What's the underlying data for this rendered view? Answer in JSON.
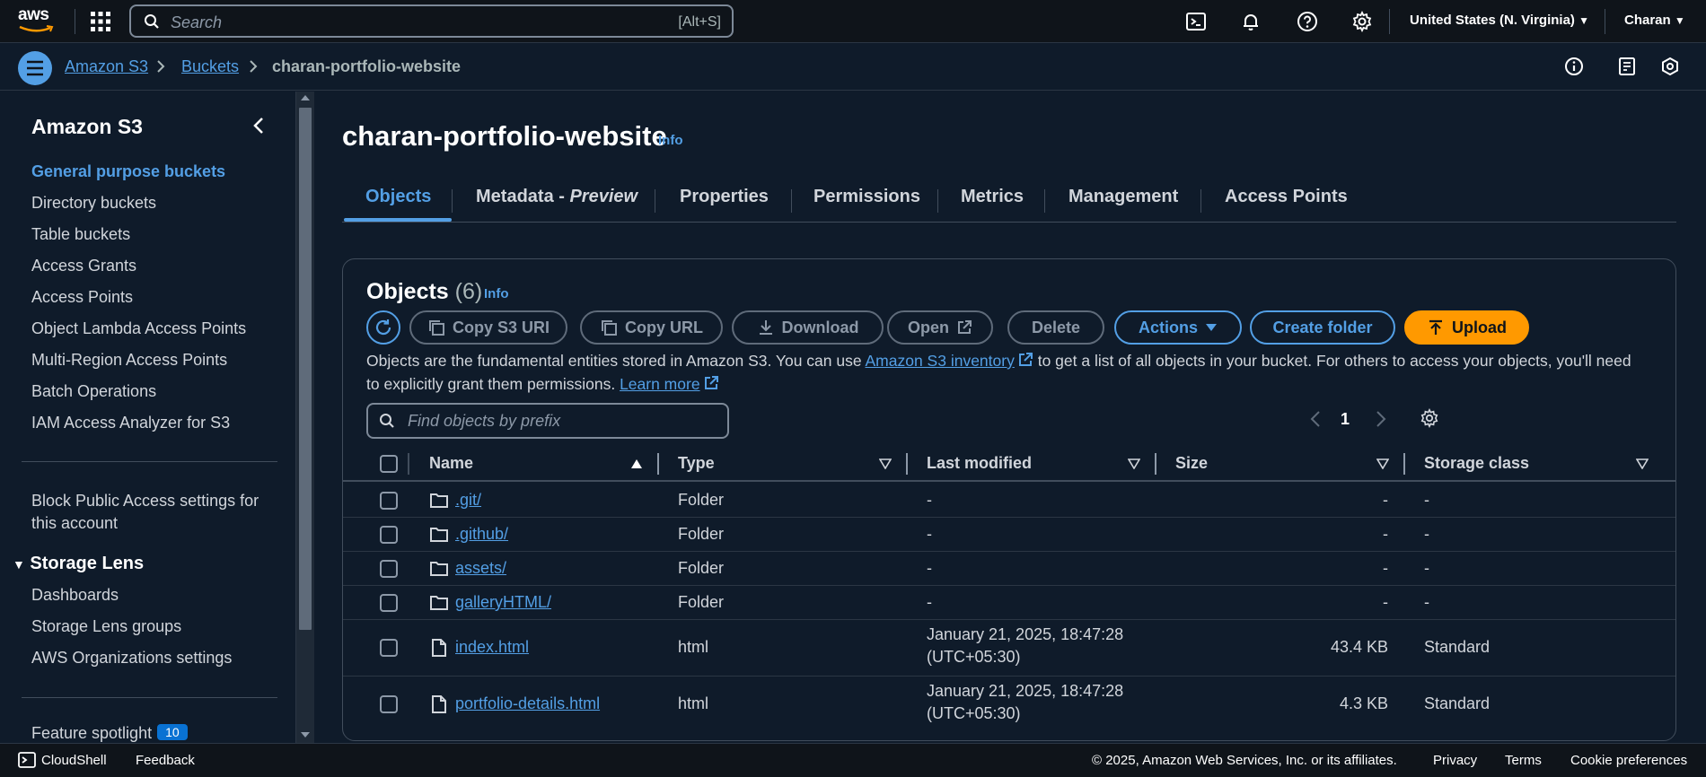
{
  "topnav": {
    "logo_text": "aws",
    "search_placeholder": "Search",
    "search_shortcut": "[Alt+S]",
    "region": "United States (N. Virginia)",
    "user": "Charan"
  },
  "breadcrumbs": {
    "items": [
      "Amazon S3",
      "Buckets"
    ],
    "current": "charan-portfolio-website"
  },
  "sidebar": {
    "title": "Amazon S3",
    "items": [
      "General purpose buckets",
      "Directory buckets",
      "Table buckets",
      "Access Grants",
      "Access Points",
      "Object Lambda Access Points",
      "Multi-Region Access Points",
      "Batch Operations",
      "IAM Access Analyzer for S3"
    ],
    "block_public_line1": "Block Public Access settings for",
    "block_public_line2": "this account",
    "storage_lens": {
      "title": "Storage Lens",
      "items": [
        "Dashboards",
        "Storage Lens groups",
        "AWS Organizations settings"
      ]
    },
    "feature_spotlight": "Feature spotlight",
    "feature_badge": "10"
  },
  "page": {
    "title": "charan-portfolio-website",
    "info": "Info"
  },
  "tabs": [
    {
      "label": "Objects"
    },
    {
      "label": "Metadata - ",
      "label_em": "Preview"
    },
    {
      "label": "Properties"
    },
    {
      "label": "Permissions"
    },
    {
      "label": "Metrics"
    },
    {
      "label": "Management"
    },
    {
      "label": "Access Points"
    }
  ],
  "objects": {
    "title": "Objects",
    "count": "(6)",
    "info": "Info",
    "buttons": {
      "copy_uri": "Copy S3 URI",
      "copy_url": "Copy URL",
      "download": "Download",
      "open": "Open",
      "delete": "Delete",
      "actions": "Actions",
      "create_folder": "Create folder",
      "upload": "Upload"
    },
    "desc_part1": "Objects are the fundamental entities stored in Amazon S3. You can use ",
    "desc_link1": "Amazon S3 inventory",
    "desc_part2": " to get a list of all objects in your bucket. For others to access your objects, you'll need to explicitly grant them permissions. ",
    "desc_link2": "Learn more",
    "find_placeholder": "Find objects by prefix",
    "page_number": "1",
    "columns": [
      "Name",
      "Type",
      "Last modified",
      "Size",
      "Storage class"
    ],
    "rows": [
      {
        "name": ".git/",
        "type": "Folder",
        "modified": "-",
        "modified2": "",
        "size": "-",
        "storage": "-",
        "icon": "folder-icon"
      },
      {
        "name": ".github/",
        "type": "Folder",
        "modified": "-",
        "modified2": "",
        "size": "-",
        "storage": "-",
        "icon": "folder-icon"
      },
      {
        "name": "assets/",
        "type": "Folder",
        "modified": "-",
        "modified2": "",
        "size": "-",
        "storage": "-",
        "icon": "folder-icon"
      },
      {
        "name": "galleryHTML/",
        "type": "Folder",
        "modified": "-",
        "modified2": "",
        "size": "-",
        "storage": "-",
        "icon": "folder-icon"
      },
      {
        "name": "index.html",
        "type": "html",
        "modified": "January 21, 2025, 18:47:28",
        "modified2": "(UTC+05:30)",
        "size": "43.4 KB",
        "storage": "Standard",
        "icon": "file-icon"
      },
      {
        "name": "portfolio-details.html",
        "type": "html",
        "modified": "January 21, 2025, 18:47:28",
        "modified2": "(UTC+05:30)",
        "size": "4.3 KB",
        "storage": "Standard",
        "icon": "file-icon"
      }
    ]
  },
  "footer": {
    "cloudshell": "CloudShell",
    "feedback": "Feedback",
    "copyright": "© 2025, Amazon Web Services, Inc. or its affiliates.",
    "privacy": "Privacy",
    "terms": "Terms",
    "cookies": "Cookie preferences"
  },
  "colors": {
    "link": "#539fe5",
    "upload_button": "#ff9900",
    "background": "#0f1b2a"
  }
}
